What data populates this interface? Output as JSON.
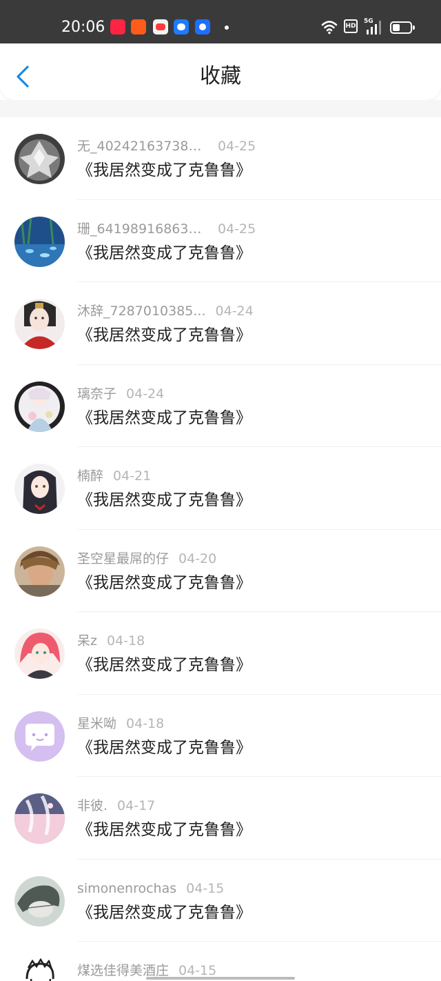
{
  "status_bar": {
    "time": "20:06",
    "notification_icons": [
      "xiaohongshu-icon",
      "app-orange-icon",
      "game-icon",
      "chat-icon",
      "browser-icon"
    ],
    "network_badge": "HD",
    "signal_label": "5G"
  },
  "header": {
    "title": "收藏",
    "back_icon": "chevron-left-icon"
  },
  "colors": {
    "accent": "#1e88e5",
    "statusbar": "#3a3a3a",
    "name_text": "#9a9a9a",
    "date_text": "#b5b5b5"
  },
  "items": [
    {
      "name": "无_402421637384...",
      "date": "04-25",
      "book": "《我居然变成了克鲁鲁》",
      "avatar": "gray-crystal"
    },
    {
      "name": "珊_641989168638...",
      "date": "04-25",
      "book": "《我居然变成了克鲁鲁》",
      "avatar": "blue-aquarium"
    },
    {
      "name": "沐辞_7287010385...",
      "date": "04-24",
      "book": "《我居然变成了克鲁鲁》",
      "avatar": "red-dress-girl"
    },
    {
      "name": "璃奈子",
      "date": "04-24",
      "book": "《我居然变成了克鲁鲁》",
      "avatar": "pastel-girl"
    },
    {
      "name": "楠醉",
      "date": "04-21",
      "book": "《我居然变成了克鲁鲁》",
      "avatar": "dark-hair-girl"
    },
    {
      "name": "圣空星最屌的仔",
      "date": "04-20",
      "book": "《我居然变成了克鲁鲁》",
      "avatar": "brown-hair-boy"
    },
    {
      "name": "呆z",
      "date": "04-18",
      "book": "《我居然变成了克鲁鲁》",
      "avatar": "pink-hair-girl"
    },
    {
      "name": "星米呦",
      "date": "04-18",
      "book": "《我居然变成了克鲁鲁》",
      "avatar": "purple-chat-bubble"
    },
    {
      "name": "非彼.",
      "date": "04-17",
      "book": "《我居然变成了克鲁鲁》",
      "avatar": "pink-sketch"
    },
    {
      "name": "simonenrochas",
      "date": "04-15",
      "book": "《我居然变成了克鲁鲁》",
      "avatar": "gray-sketch"
    },
    {
      "name": "煤选佳得美酒庄",
      "date": "04-15",
      "book": "",
      "avatar": "line-drawing-man"
    }
  ]
}
